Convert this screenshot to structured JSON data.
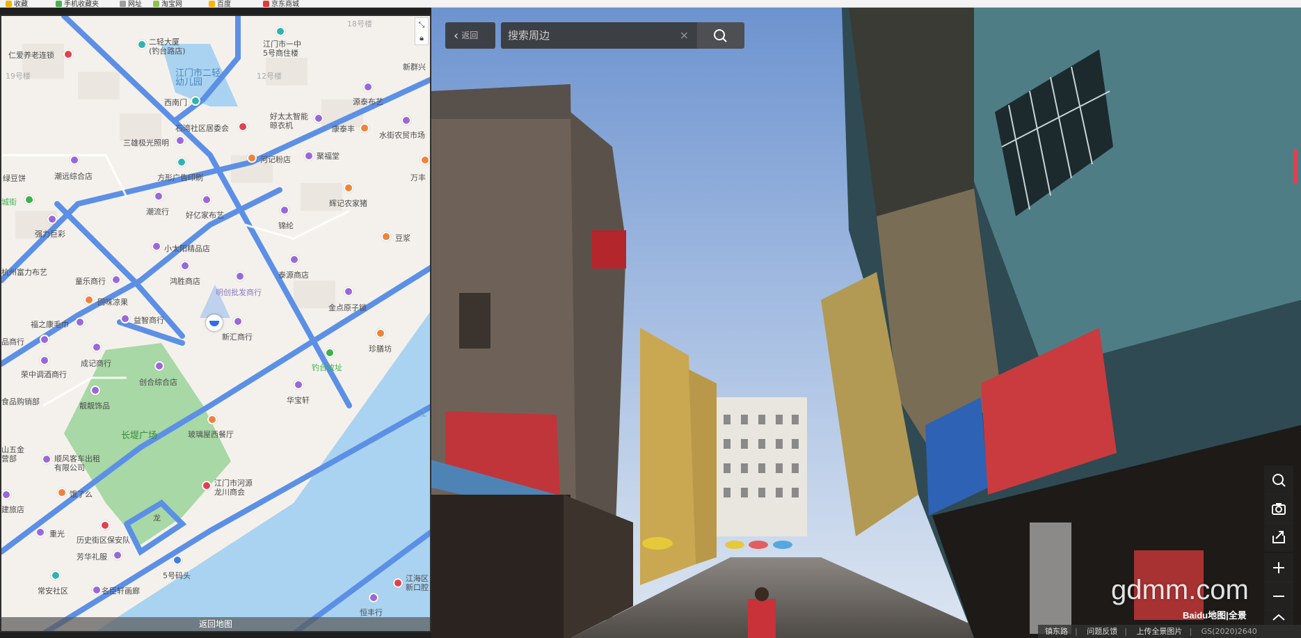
{
  "bookmarks": [
    "收藏",
    "手机收藏夹",
    "网址",
    "淘宝网",
    "百度",
    "京东商城"
  ],
  "map": {
    "return_label": "返回地图",
    "labels": [
      {
        "text": "仁爱养老连锁",
        "cls": "red"
      },
      {
        "text": "二轻大厦\n(钓台路店)",
        "cls": "teal"
      },
      {
        "text": "江门市一中\n5号商住楼",
        "cls": "teal"
      },
      {
        "text": "18号楼",
        "cls": ""
      },
      {
        "text": "江门市二轻\n幼儿园",
        "cls": ""
      },
      {
        "text": "19号楼",
        "cls": ""
      },
      {
        "text": "12号楼",
        "cls": ""
      },
      {
        "text": "新群兴",
        "cls": "purple"
      },
      {
        "text": "源泰布艺",
        "cls": "purple"
      },
      {
        "text": "西南门",
        "cls": "teal"
      },
      {
        "text": "好太太智能\n晾衣机",
        "cls": "purple"
      },
      {
        "text": "康泰丰",
        "cls": "orange"
      },
      {
        "text": "水街农贸市场",
        "cls": "purple"
      },
      {
        "text": "石湾社区居委会",
        "cls": "red"
      },
      {
        "text": "三雄极光照明",
        "cls": "purple"
      },
      {
        "text": "河记粉店",
        "cls": "orange"
      },
      {
        "text": "聚福堂",
        "cls": "purple"
      },
      {
        "text": "万丰",
        "cls": "orange"
      },
      {
        "text": "绿豆饼",
        "cls": ""
      },
      {
        "text": "潮远综合店",
        "cls": "purple"
      },
      {
        "text": "方形广告印刷",
        "cls": "teal"
      },
      {
        "text": "辉记农家猪",
        "cls": "orange"
      },
      {
        "text": "城街",
        "cls": "green"
      },
      {
        "text": "潮流行",
        "cls": "purple"
      },
      {
        "text": "好亿家布艺",
        "cls": "purple"
      },
      {
        "text": "锦纶",
        "cls": "purple"
      },
      {
        "text": "强力巨彩",
        "cls": "purple"
      },
      {
        "text": "豆浆",
        "cls": "orange"
      },
      {
        "text": "小太阳精品店",
        "cls": "purple"
      },
      {
        "text": "杭州富力布艺",
        "cls": ""
      },
      {
        "text": "泰源商店",
        "cls": "purple"
      },
      {
        "text": "童乐商行",
        "cls": "purple"
      },
      {
        "text": "鸿胜商店",
        "cls": "purple"
      },
      {
        "text": "明创批发商行",
        "cls": "purple"
      },
      {
        "text": "回味凉果",
        "cls": "orange"
      },
      {
        "text": "金点原子锁",
        "cls": "purple"
      },
      {
        "text": "福之康毛巾",
        "cls": "purple"
      },
      {
        "text": "益智商行",
        "cls": "purple"
      },
      {
        "text": "新汇商行",
        "cls": "purple"
      },
      {
        "text": "珍膳坊",
        "cls": "orange"
      },
      {
        "text": "品商行",
        "cls": "purple"
      },
      {
        "text": "成记商行",
        "cls": "purple"
      },
      {
        "text": "钓台故址",
        "cls": "green"
      },
      {
        "text": "荣中调酒商行",
        "cls": "purple"
      },
      {
        "text": "创合综合店",
        "cls": "purple"
      },
      {
        "text": "华宝轩",
        "cls": "purple"
      },
      {
        "text": "食品购销部",
        "cls": "purple"
      },
      {
        "text": "靓靓饰品",
        "cls": "purple"
      },
      {
        "text": "长堤广场",
        "cls": ""
      },
      {
        "text": "玻璃屋西餐厅",
        "cls": "orange"
      },
      {
        "text": "山五金\n营部",
        "cls": "purple"
      },
      {
        "text": "顺风客车出租\n有限公司",
        "cls": "purple"
      },
      {
        "text": "饿了么",
        "cls": "orange"
      },
      {
        "text": "江门市河源\n龙川商会",
        "cls": "red"
      },
      {
        "text": "建旅店",
        "cls": "purple"
      },
      {
        "text": "重光",
        "cls": "purple"
      },
      {
        "text": "历史街区保安队",
        "cls": "red"
      },
      {
        "text": "龙",
        "cls": ""
      },
      {
        "text": "芳华礼服",
        "cls": "purple"
      },
      {
        "text": "5号码头",
        "cls": "blue"
      },
      {
        "text": "常安社区",
        "cls": "teal"
      },
      {
        "text": "名臣轩画廊",
        "cls": "purple"
      },
      {
        "text": "江海区\n新口腔",
        "cls": "red"
      },
      {
        "text": "恒丰行",
        "cls": "purple"
      },
      {
        "text": "江",
        "cls": ""
      }
    ]
  },
  "search": {
    "back_label": "返回",
    "placeholder": "搜索周边",
    "clear": "×"
  },
  "watermark": "gdmm.com",
  "brand": "Baidu地图|全景",
  "footer": {
    "road": "镇东路",
    "feedback": "问题反馈",
    "upload": "上传全景图片",
    "license": "GS(2020)2640"
  }
}
